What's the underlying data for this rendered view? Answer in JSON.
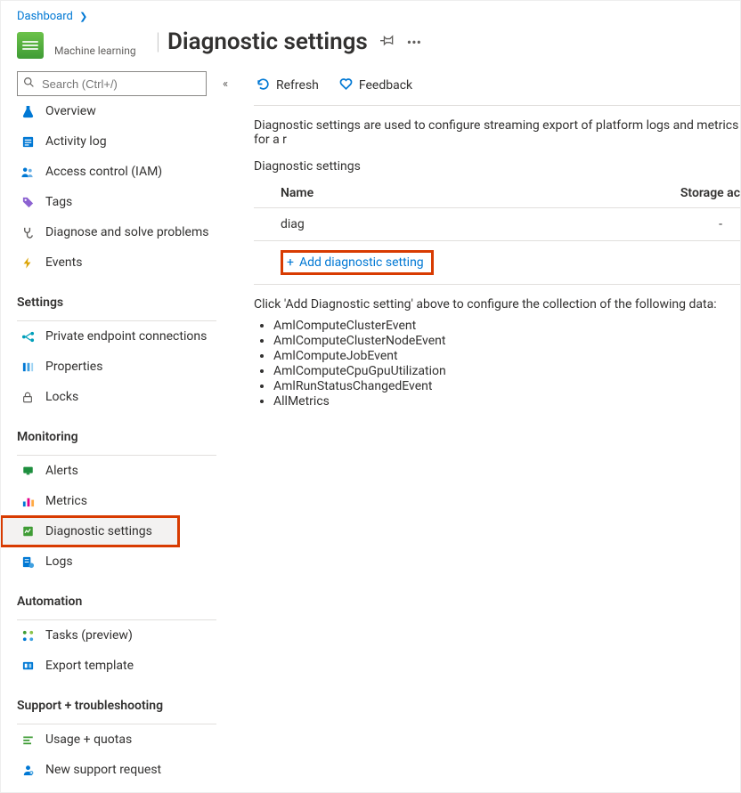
{
  "breadcrumb": {
    "dashboard": "Dashboard"
  },
  "resource": {
    "type_label": "Machine learning"
  },
  "page": {
    "title": "Diagnostic settings"
  },
  "search": {
    "placeholder": "Search (Ctrl+/)"
  },
  "nav": {
    "overview": "Overview",
    "activity_log": "Activity log",
    "access_control": "Access control (IAM)",
    "tags": "Tags",
    "diagnose": "Diagnose and solve problems",
    "events": "Events",
    "section_settings": "Settings",
    "private_endpoint": "Private endpoint connections",
    "properties": "Properties",
    "locks": "Locks",
    "section_monitoring": "Monitoring",
    "alerts": "Alerts",
    "metrics": "Metrics",
    "diagnostic_settings": "Diagnostic settings",
    "logs": "Logs",
    "section_automation": "Automation",
    "tasks": "Tasks (preview)",
    "export_template": "Export template",
    "section_support": "Support + troubleshooting",
    "usage_quotas": "Usage + quotas",
    "new_support": "New support request"
  },
  "toolbar": {
    "refresh": "Refresh",
    "feedback": "Feedback"
  },
  "content": {
    "description": "Diagnostic settings are used to configure streaming export of platform logs and metrics for a r",
    "subheading": "Diagnostic settings",
    "col_name": "Name",
    "col_storage": "Storage ac",
    "row_name": "diag",
    "row_storage": "-",
    "add_label": "Add diagnostic setting",
    "note": "Click 'Add Diagnostic setting' above to configure the collection of the following data:",
    "types": {
      "t0": "AmlComputeClusterEvent",
      "t1": "AmlComputeClusterNodeEvent",
      "t2": "AmlComputeJobEvent",
      "t3": "AmlComputeCpuGpuUtilization",
      "t4": "AmlRunStatusChangedEvent",
      "t5": "AllMetrics"
    }
  }
}
